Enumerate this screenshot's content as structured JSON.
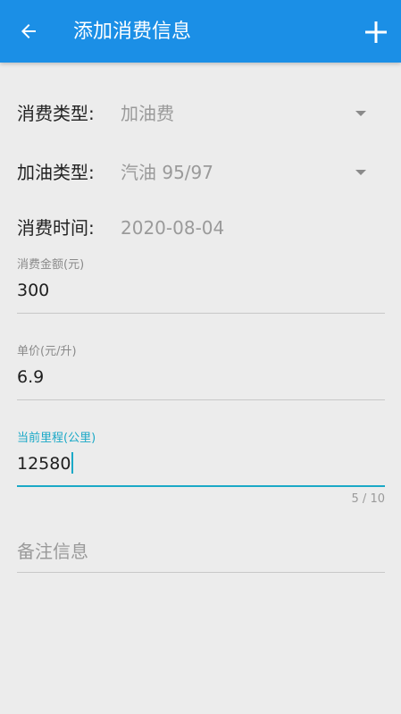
{
  "header": {
    "title": "添加消费信息",
    "bar_color": "#1b8fe6",
    "back_icon": "arrow-left-icon",
    "add_icon": "plus-icon"
  },
  "form": {
    "consume_type": {
      "label": "消费类型:",
      "value": "加油费"
    },
    "fuel_type": {
      "label": "加油类型:",
      "value": "汽油 95/97"
    },
    "consume_time": {
      "label": "消费时间:",
      "value": "2020-08-04"
    },
    "amount": {
      "label": "消费金额(元)",
      "value": "300"
    },
    "unit_price": {
      "label": "单价(元/升)",
      "value": "6.9"
    },
    "mileage": {
      "label": "当前里程(公里)",
      "value": "12580",
      "counter": "5 / 10"
    },
    "remark": {
      "placeholder": "备注信息"
    }
  },
  "accent_color": "#1ba9c7"
}
